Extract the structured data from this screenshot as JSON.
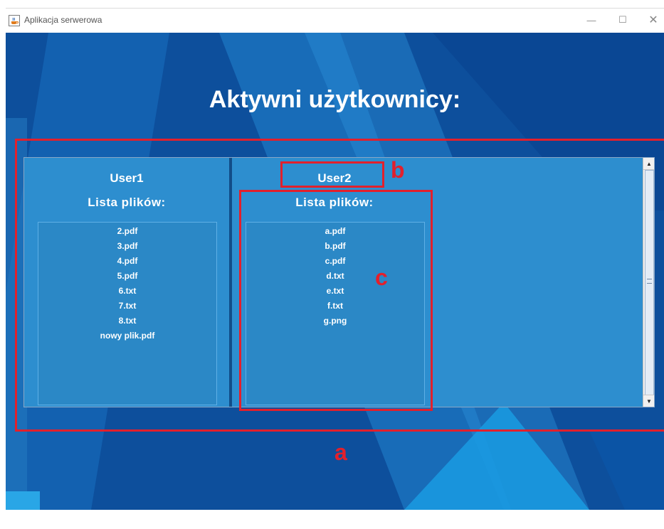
{
  "window": {
    "title": "Aplikacja serwerowa",
    "icon": "java-cup-icon",
    "controls": {
      "minimize": "—",
      "maximize": "☐",
      "close": "✕"
    }
  },
  "main": {
    "title": "Aktywni użytkownicy:",
    "users": [
      {
        "name": "User1",
        "list_title": "Lista plików:",
        "files": [
          "2.pdf",
          "3.pdf",
          "4.pdf",
          "5.pdf",
          "6.txt",
          "7.txt",
          "8.txt",
          "nowy plik.pdf"
        ]
      },
      {
        "name": "User2",
        "list_title": "Lista plików:",
        "files": [
          "a.pdf",
          "b.pdf",
          "c.pdf",
          "d.txt",
          "e.txt",
          "f.txt",
          "g.png"
        ]
      }
    ]
  },
  "annotations": {
    "a": "a",
    "b": "b",
    "c": "c"
  },
  "colors": {
    "background": "#0d4f9c",
    "panel": "#2d8ecf",
    "annotation": "#e2202c",
    "text": "#ffffff"
  }
}
